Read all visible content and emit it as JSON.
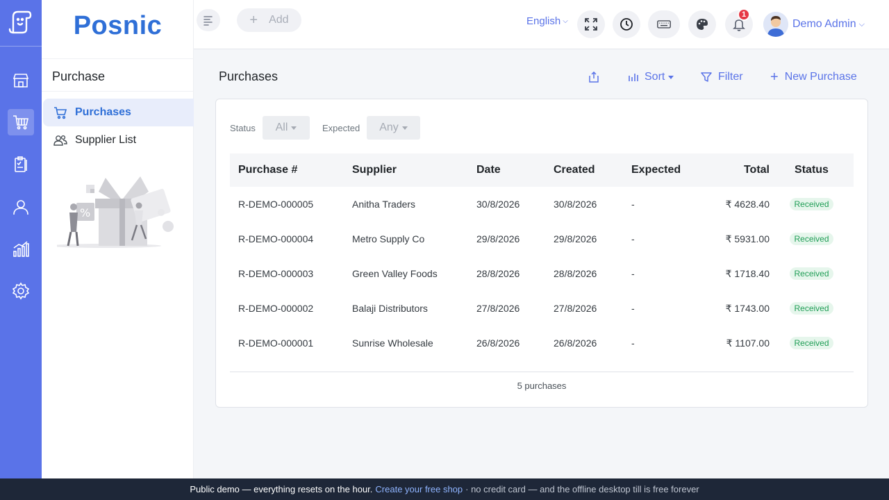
{
  "brand": "Posnic",
  "rail": {
    "items": [
      {
        "name": "store-icon"
      },
      {
        "name": "cart-icon",
        "active": true
      },
      {
        "name": "clipboard-icon"
      },
      {
        "name": "person-icon"
      },
      {
        "name": "chart-icon"
      },
      {
        "name": "gear-icon"
      }
    ]
  },
  "sidebar": {
    "section_title": "Purchase",
    "items": [
      {
        "label": "Purchases",
        "icon": "cart-icon",
        "active": true
      },
      {
        "label": "Supplier List",
        "icon": "users-icon",
        "active": false
      }
    ]
  },
  "header": {
    "add_label": "Add",
    "language": "English",
    "notification_count": "1",
    "user_name": "Demo Admin"
  },
  "page": {
    "title": "Purchases",
    "sort_label": "Sort",
    "filter_label": "Filter",
    "new_label": "New Purchase"
  },
  "filters": {
    "status_label": "Status",
    "status_value": "All",
    "expected_label": "Expected",
    "expected_value": "Any"
  },
  "table": {
    "headers": {
      "purchase": "Purchase #",
      "supplier": "Supplier",
      "date": "Date",
      "created": "Created",
      "expected": "Expected",
      "total": "Total",
      "status": "Status"
    },
    "rows": [
      {
        "purchase": "R-DEMO-000005",
        "supplier": "Anitha Traders",
        "date": "30/8/2026",
        "created": "30/8/2026",
        "expected": "-",
        "total": "₹ 4628.40",
        "status": "Received"
      },
      {
        "purchase": "R-DEMO-000004",
        "supplier": "Metro Supply Co",
        "date": "29/8/2026",
        "created": "29/8/2026",
        "expected": "-",
        "total": "₹ 5931.00",
        "status": "Received"
      },
      {
        "purchase": "R-DEMO-000003",
        "supplier": "Green Valley Foods",
        "date": "28/8/2026",
        "created": "28/8/2026",
        "expected": "-",
        "total": "₹ 1718.40",
        "status": "Received"
      },
      {
        "purchase": "R-DEMO-000002",
        "supplier": "Balaji Distributors",
        "date": "27/8/2026",
        "created": "27/8/2026",
        "expected": "-",
        "total": "₹ 1743.00",
        "status": "Received"
      },
      {
        "purchase": "R-DEMO-000001",
        "supplier": "Sunrise Wholesale",
        "date": "26/8/2026",
        "created": "26/8/2026",
        "expected": "-",
        "total": "₹ 1107.00",
        "status": "Received"
      }
    ],
    "footer": "5 purchases"
  },
  "banner": {
    "text": "Public demo — everything resets on the hour.",
    "link": "Create your free shop",
    "tail": "· no credit card — and the offline desktop till is free forever"
  },
  "colors": {
    "accent": "#5a73e8",
    "brand": "#2f6fd7",
    "status_received": "#1f9d55"
  }
}
